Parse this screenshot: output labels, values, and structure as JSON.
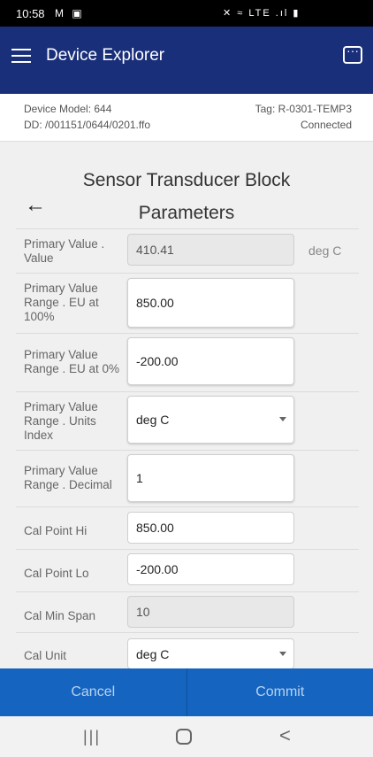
{
  "status_bar": {
    "time": "10:58",
    "left_icons": "M ▣",
    "right_icons": "✕ ≈ LTE .ıl ▮"
  },
  "app_bar": {
    "title": "Device Explorer",
    "menu_icon": "hamburger-menu-icon",
    "action_icon": "chat-options-icon"
  },
  "device_info": {
    "model": "Device Model: 644",
    "dd": "DD: /001151/0644/0201.ffo",
    "tag": "Tag: R-0301-TEMP3",
    "status": "Connected"
  },
  "block": {
    "title": "Sensor Transducer Block",
    "subtitle": "Parameters",
    "back_icon": "←"
  },
  "params": [
    {
      "label": "Primary Value . Value",
      "value": "410.41",
      "unit": "deg C",
      "readonly": true,
      "type": "text"
    },
    {
      "label": "Primary Value Range . EU at 100%",
      "value": "850.00",
      "unit": "",
      "readonly": false,
      "type": "text"
    },
    {
      "label": "Primary Value Range . EU at 0%",
      "value": "-200.00",
      "unit": "",
      "readonly": false,
      "type": "text"
    },
    {
      "label": "Primary Value Range . Units Index",
      "value": "deg C",
      "unit": "",
      "readonly": false,
      "type": "select"
    },
    {
      "label": "Primary Value Range . Decimal",
      "value": "1",
      "unit": "",
      "readonly": false,
      "type": "text"
    },
    {
      "label": "Cal Point Hi",
      "value": "850.00",
      "unit": "",
      "readonly": false,
      "type": "text"
    },
    {
      "label": "Cal Point Lo",
      "value": "-200.00",
      "unit": "",
      "readonly": false,
      "type": "text"
    },
    {
      "label": "Cal Min Span",
      "value": "10",
      "unit": "",
      "readonly": true,
      "type": "text"
    },
    {
      "label": "Cal Unit",
      "value": "deg C",
      "unit": "",
      "readonly": false,
      "type": "select"
    }
  ],
  "actions": {
    "cancel": "Cancel",
    "commit": "Commit"
  },
  "nav": {
    "recent": "|||",
    "back": "<"
  },
  "colors": {
    "app_bar": "#1a2f7a",
    "bottom_bar": "#1565c0",
    "button_text": "#b8d2ef"
  }
}
